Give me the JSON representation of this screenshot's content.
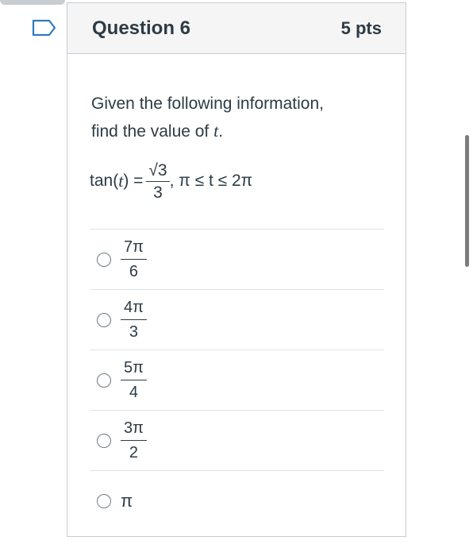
{
  "question": {
    "title": "Question 6",
    "points": "5 pts",
    "text_line1": "Given the following information,",
    "text_line2_prefix": "find the value of ",
    "text_variable": "t",
    "text_line2_suffix": "."
  },
  "equation": {
    "lhs_func": "tan(",
    "lhs_var": "t",
    "lhs_close": ") =",
    "numerator": "√3",
    "denominator": "3",
    "condition": ", π ≤ t ≤ 2π"
  },
  "answers": [
    {
      "numerator": "7π",
      "denominator": "6"
    },
    {
      "numerator": "4π",
      "denominator": "3"
    },
    {
      "numerator": "5π",
      "denominator": "4"
    },
    {
      "numerator": "3π",
      "denominator": "2"
    },
    {
      "plain": "π"
    }
  ],
  "colors": {
    "text": "#2d3b45",
    "border": "#c7cdd1",
    "header_bg": "#f5f5f5",
    "flag_outline": "#2d7cc1"
  },
  "icons": {
    "flag": "bookmark-flag-icon"
  }
}
